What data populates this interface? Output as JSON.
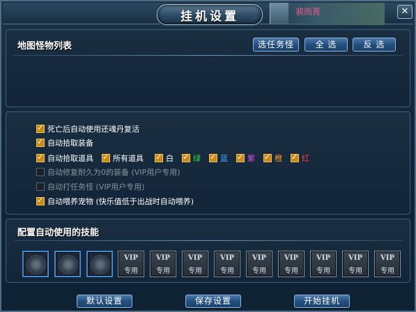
{
  "window": {
    "title": "挂机设置",
    "close_label": "✕",
    "scene_name": "裴雨菁"
  },
  "monster_panel": {
    "title": "地图怪物列表",
    "buttons": {
      "select_task": "选任务怪",
      "select_all": "全 选",
      "invert": "反 选"
    }
  },
  "options": [
    {
      "label": "死亡后自动使用还魂丹复活",
      "checked": true,
      "enabled": true
    },
    {
      "label": "自动拾取装备",
      "checked": true,
      "enabled": true
    },
    {
      "label": "自动拾取道具",
      "checked": true,
      "enabled": true
    },
    {
      "label": "自动修复耐久为0的装备 (VIP用户专用)",
      "checked": false,
      "enabled": false
    },
    {
      "label": "自动打任务怪 (VIP用户专用)",
      "checked": false,
      "enabled": false
    },
    {
      "label": "自动喂养宠物 (快乐值低于出战时自动喂养)",
      "checked": true,
      "enabled": true
    }
  ],
  "item_filters": [
    {
      "label": "所有道具",
      "color": "#ffffff",
      "checked": true
    },
    {
      "label": "白",
      "color": "#ffffff",
      "checked": true
    },
    {
      "label": "绿",
      "color": "#3ed33e",
      "checked": true
    },
    {
      "label": "蓝",
      "color": "#3fa9ff",
      "checked": true
    },
    {
      "label": "紫",
      "color": "#e04ae0",
      "checked": true
    },
    {
      "label": "橙",
      "color": "#ff9a2a",
      "checked": true
    },
    {
      "label": "红",
      "color": "#ff3b3b",
      "checked": true
    }
  ],
  "skills_panel": {
    "title": "配置自动使用的技能",
    "slots": [
      {
        "type": "empty"
      },
      {
        "type": "empty"
      },
      {
        "type": "empty"
      },
      {
        "type": "vip",
        "line1": "VIP",
        "line2": "专用"
      },
      {
        "type": "vip",
        "line1": "VIP",
        "line2": "专用"
      },
      {
        "type": "vip",
        "line1": "VIP",
        "line2": "专用"
      },
      {
        "type": "vip",
        "line1": "VIP",
        "line2": "专用"
      },
      {
        "type": "vip",
        "line1": "VIP",
        "line2": "专用"
      },
      {
        "type": "vip",
        "line1": "VIP",
        "line2": "专用"
      },
      {
        "type": "vip",
        "line1": "VIP",
        "line2": "专用"
      },
      {
        "type": "vip",
        "line1": "VIP",
        "line2": "专用"
      },
      {
        "type": "vip",
        "line1": "VIP",
        "line2": "专用"
      }
    ]
  },
  "footer": {
    "default_btn": "默认设置",
    "save_btn": "保存设置",
    "start_btn": "开始挂机"
  }
}
